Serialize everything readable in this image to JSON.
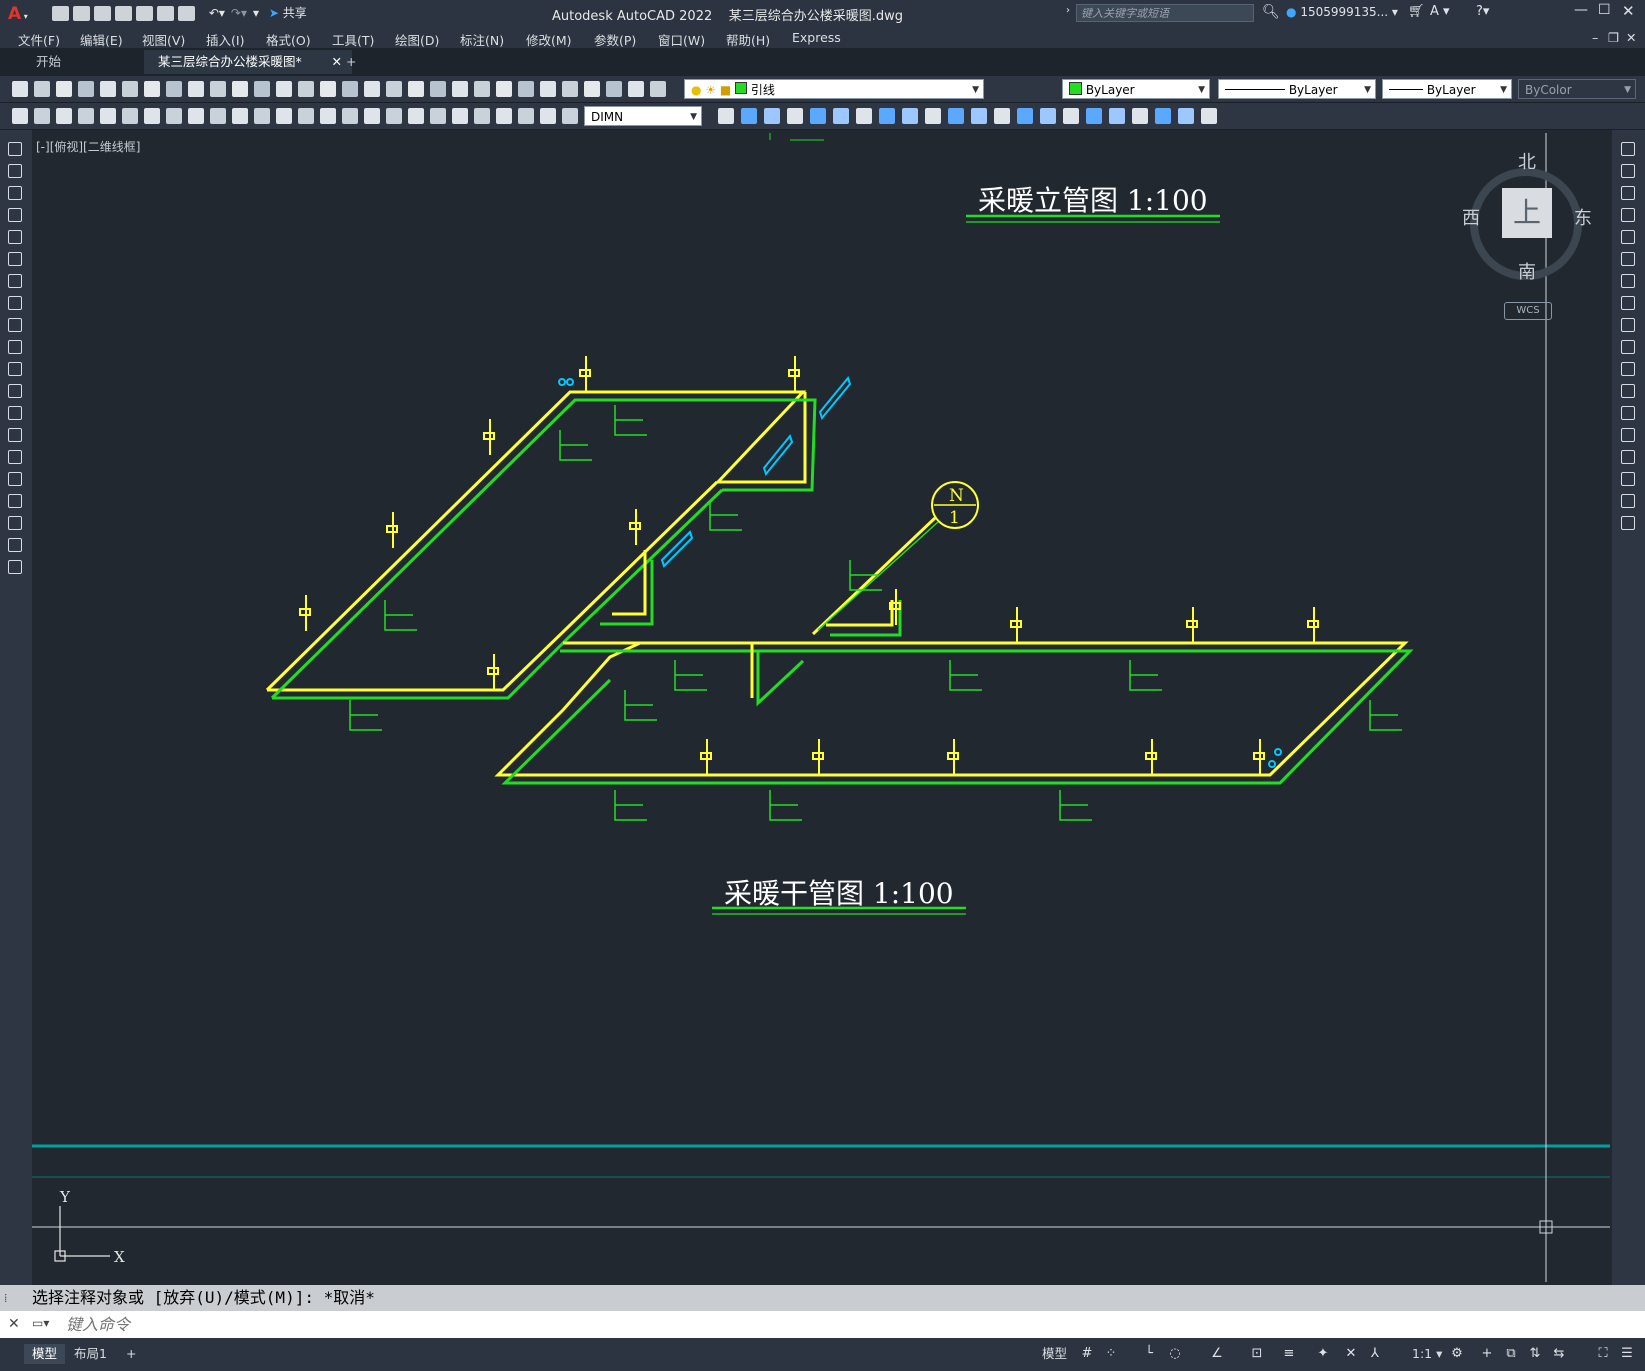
{
  "app": {
    "title": "Autodesk AutoCAD 2022",
    "filename": "某三层综合办公楼采暖图.dwg",
    "share_label": "共享",
    "search_placeholder": "键入关键字或短语",
    "user": "1505999135...",
    "help_icon": "help-icon"
  },
  "menu": [
    "文件(F)",
    "编辑(E)",
    "视图(V)",
    "插入(I)",
    "格式(O)",
    "工具(T)",
    "绘图(D)",
    "标注(N)",
    "修改(M)",
    "参数(P)",
    "窗口(W)",
    "帮助(H)",
    "Express"
  ],
  "tabs": {
    "start": "开始",
    "document": "某三层综合办公楼采暖图*",
    "add": "+"
  },
  "toolbar": {
    "layer_name": "引线",
    "color": "ByLayer",
    "linetype": "ByLayer",
    "lineweight": "ByLayer",
    "plotstyle": "ByColor",
    "dimstyle": "DIMN"
  },
  "viewport": {
    "label": "[-][俯视][二维线框]"
  },
  "viewcube": {
    "north": "北",
    "south": "南",
    "east": "东",
    "west": "西",
    "top": "上",
    "wcs": "WCS"
  },
  "drawing": {
    "title_riser": "采暖立管图 1:100",
    "title_main": "采暖干管图 1:100",
    "north_symbol_top": "N",
    "north_symbol_bottom": "1",
    "ucs_x": "X",
    "ucs_y": "Y",
    "colors": {
      "pipe_supply": "#ffff33",
      "pipe_return": "#22dd22",
      "accent": "#00c8ff",
      "background": "#212830",
      "baseline": "#00a0a0"
    }
  },
  "command": {
    "history": "选择注释对象或 [放弃(U)/模式(M)]: *取消*",
    "placeholder": "键入命令"
  },
  "status": {
    "model_tab": "模型",
    "layout_tab": "布局1",
    "add": "+",
    "model_button": "模型",
    "scale": "1:1"
  }
}
